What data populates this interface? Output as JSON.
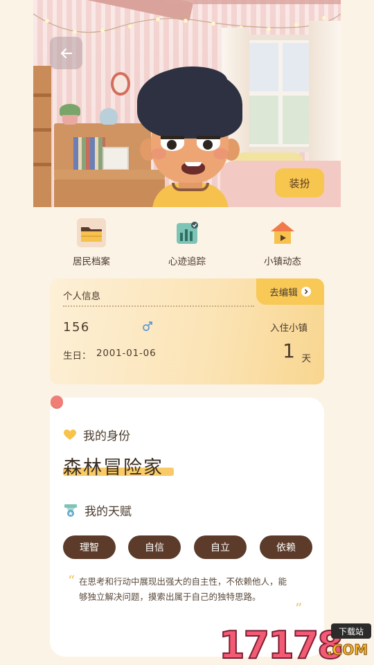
{
  "hero": {
    "dress_button_label": "装扮"
  },
  "nav": [
    {
      "label": "居民档案",
      "icon": "folder-icon"
    },
    {
      "label": "心迹追踪",
      "icon": "bar-chart-icon"
    },
    {
      "label": "小镇动态",
      "icon": "house-video-icon"
    }
  ],
  "info_card": {
    "title": "个人信息",
    "edit_label": "去编辑",
    "user_id": "156",
    "gender_symbol": "♂",
    "birthday_label": "生日：",
    "birthday_value": "2001-01-06",
    "stay_label": "入住小镇",
    "stay_days": "1",
    "stay_unit": "天"
  },
  "identity_card": {
    "identity_heading": "我的身份",
    "identity_value": "森林冒险家",
    "talent_heading": "我的天赋",
    "talents": [
      "理智",
      "自信",
      "自立",
      "依赖"
    ],
    "description": "在思考和行动中展现出强大的自主性，不依赖他人，能够独立解决问题，摸索出属于自己的独特思路。"
  },
  "watermark": {
    "number": "17178",
    "site_label": "下载站",
    "domain": ".COM"
  },
  "colors": {
    "background": "#fbf3e6",
    "accent_yellow": "#f8c957",
    "tag_brown": "#5c3b2a",
    "pin_red": "#ee7e76"
  }
}
